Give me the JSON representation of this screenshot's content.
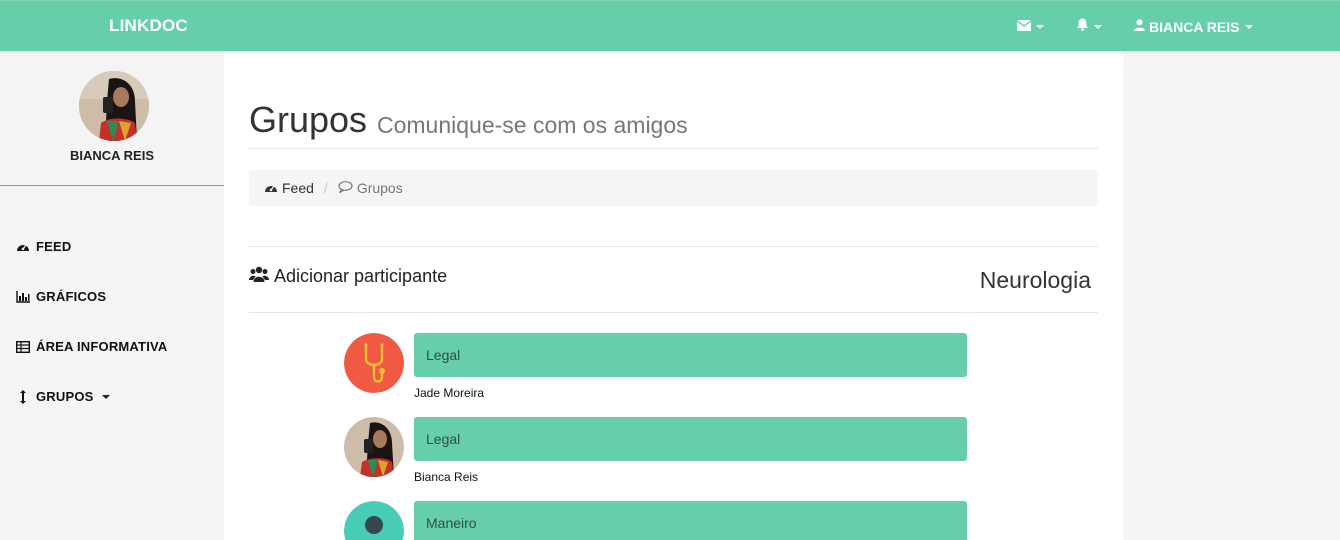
{
  "navbar": {
    "brand": "LINKDOC",
    "user_label": "BIANCA REIS",
    "icons": [
      "envelope-icon",
      "bell-icon",
      "user-icon"
    ],
    "color": "#66cfa9"
  },
  "sidebar": {
    "profile_name": "BIANCA REIS",
    "items": [
      {
        "label": "FEED",
        "icon": "dashboard-icon"
      },
      {
        "label": "GRÁFICOS",
        "icon": "bar-chart-icon"
      },
      {
        "label": "ÁREA INFORMATIVA",
        "icon": "table-icon"
      },
      {
        "label": "GRUPOS",
        "icon": "sort-icon"
      }
    ]
  },
  "page": {
    "title": "Grupos",
    "subtitle": "Comunique-se com os amigos"
  },
  "breadcrumb": {
    "items": [
      {
        "label": "Feed",
        "icon": "dashboard-icon"
      },
      {
        "label": "Grupos",
        "icon": "comment-icon"
      }
    ],
    "separator": "/"
  },
  "group": {
    "add_participant_label": "Adicionar participante",
    "name": "Neurologia"
  },
  "messages": [
    {
      "text": "Legal",
      "author": "Jade Moreira",
      "avatar": "stethoscope-avatar"
    },
    {
      "text": "Legal",
      "author": "Bianca Reis",
      "avatar": "user-photo-avatar"
    },
    {
      "text": "Maneiro",
      "author": "",
      "avatar": "silhouette-avatar"
    }
  ]
}
